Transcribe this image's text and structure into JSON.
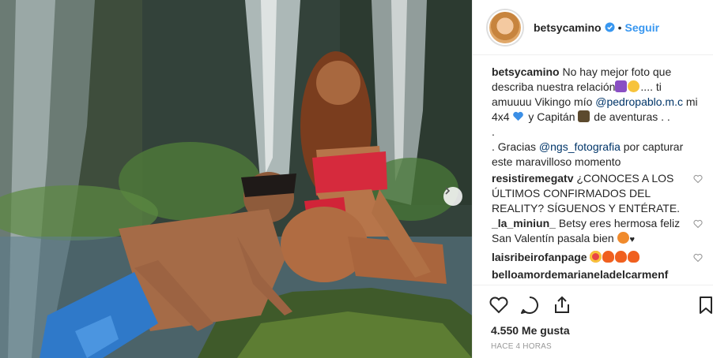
{
  "post": {
    "photo_alt": "",
    "next_arrow": "chevron-right-icon"
  },
  "header": {
    "username": "betsycamino",
    "verified": true,
    "separator": "•",
    "follow_label": "Seguir"
  },
  "caption": {
    "username": "betsycamino",
    "text_1": "No hay mejor foto que describa nuestra relación",
    "text_2": ".... ti amuuuu Vikingo mío ",
    "mention_1": "@pedropablo.m.c",
    "text_3": " mi 4x4 ",
    "text_4": " y Capitán ",
    "text_5": " de aventuras . .",
    "line_dot": ".",
    "text_6": ". Gracias ",
    "mention_2": "@ngs_fotografia",
    "text_7": " por capturar este maravilloso momento"
  },
  "comments": [
    {
      "username": "resistiremegatv",
      "text": "¿CONOCES A LOS ÚLTIMOS CONFIRMADOS DEL REALITY? SÍGUENOS Y ENTÉRATE."
    },
    {
      "username": "_la_miniun_",
      "text": "Betsy eres hermosa feliz San Valentín pasala bien"
    },
    {
      "username": "laisribeirofanpage",
      "text": ""
    },
    {
      "username": "belloamordemarianeladelcarmenf",
      "text": ""
    }
  ],
  "actions": {
    "likes": "4.550 Me gusta",
    "time": "Hace 4 horas"
  },
  "colors": {
    "link": "#3897f0",
    "mention": "#003569",
    "verified": "#3897f0",
    "muted": "#999999"
  }
}
